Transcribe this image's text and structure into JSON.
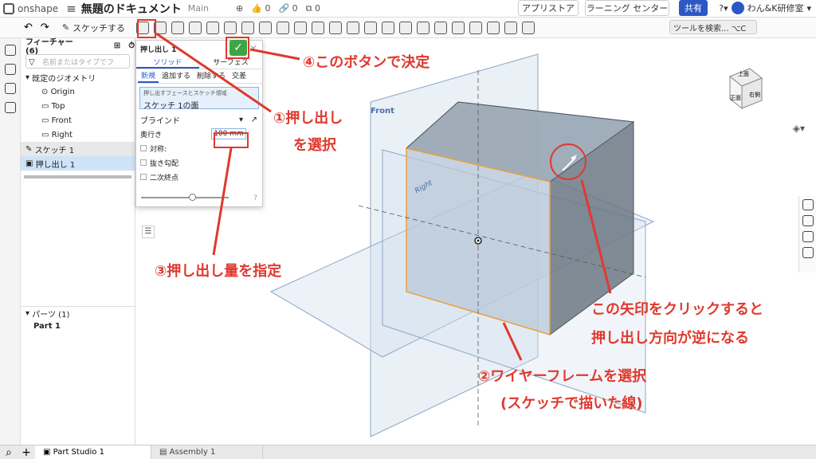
{
  "header": {
    "logo": "onshape",
    "doc_title": "無題のドキュメント",
    "branch": "Main",
    "likes": "0",
    "links": "0",
    "copies": "0",
    "btn_appstore": "アプリストア",
    "btn_learning": "ラーニング センター",
    "btn_share": "共有",
    "user": "わん&K研修室"
  },
  "toolbar": {
    "sketch": "スケッチする",
    "tool_search": "ツールを検索... ⌥C"
  },
  "feature_list": {
    "title": "フィーチャー (6)",
    "filter_placeholder": "名前またはタイプでフ",
    "default_geometry": "既定のジオメトリ",
    "origin": "Origin",
    "top": "Top",
    "front": "Front",
    "right": "Right",
    "sketch1": "スケッチ 1",
    "extrude1": "押し出し 1",
    "parts_head": "パーツ (1)",
    "part1": "Part 1"
  },
  "dialog": {
    "title": "押し出し 1",
    "tab_solid": "ソリッド",
    "tab_surface": "サーフェス",
    "sub_new": "新規",
    "sub_add": "追加する",
    "sub_remove": "削除する",
    "sub_intersect": "交差",
    "sel_caption": "押し出すフェースとスケッチ領域",
    "sel_value": "スケッチ 1の面",
    "blind": "ブラインド",
    "depth_label": "奥行き",
    "depth_value": "100 mm",
    "symmetric": "対称:",
    "draft": "抜き勾配",
    "second_end": "二次終点"
  },
  "viewcube": {
    "top": "上面",
    "front": "正面",
    "right": "右側"
  },
  "viewport": {
    "plane_front": "Front",
    "plane_right": "Right"
  },
  "annotations": {
    "a1_line1": "①押し出し",
    "a1_line2": "を選択",
    "a2_line1": "②ワイヤーフレームを選択",
    "a2_line2": "(スケッチで描いた線)",
    "a3": "③押し出し量を指定",
    "a4": "④このボタンで決定",
    "a5_line1": "この矢印をクリックすると",
    "a5_line2": "押し出し方向が逆になる"
  },
  "bottom_tabs": {
    "part_studio": "Part Studio 1",
    "assembly": "Assembly 1"
  },
  "colors": {
    "annotation": "#e0392e",
    "ok_button": "#3da544",
    "accent": "#2b58c4"
  }
}
